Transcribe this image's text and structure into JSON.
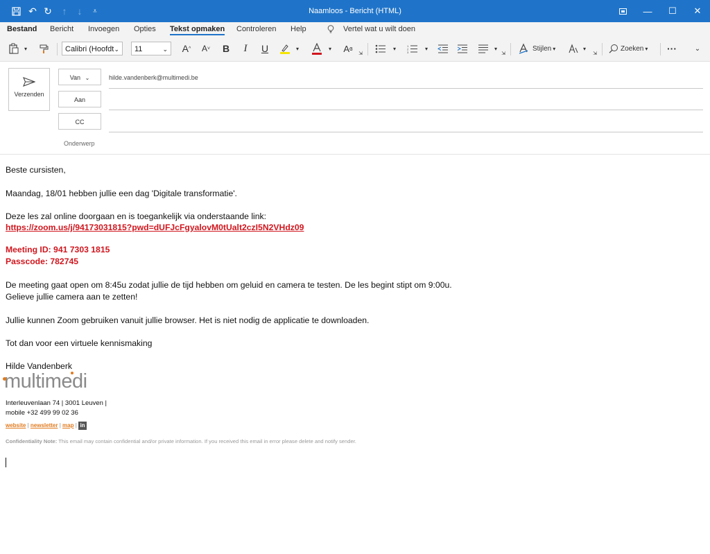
{
  "window": {
    "title": "Naamloos  -  Bericht (HTML)"
  },
  "tabs": [
    {
      "label": "Bestand"
    },
    {
      "label": "Bericht"
    },
    {
      "label": "Invoegen"
    },
    {
      "label": "Opties"
    },
    {
      "label": "Tekst opmaken"
    },
    {
      "label": "Controleren"
    },
    {
      "label": "Help"
    }
  ],
  "tellme": {
    "label": "Vertel wat u wilt doen"
  },
  "ribbon": {
    "font_name": "Calibri (Hoofdt",
    "font_size": "11",
    "styles_label": "Stijlen",
    "search_label": "Zoeken",
    "bold": "B",
    "italic": "I",
    "underline": "U",
    "grow": "A",
    "shrink": "A",
    "more": "···"
  },
  "compose": {
    "send_label": "Verzenden",
    "from_label": "Van",
    "from_value": "hilde.vandenberk@multimedi.be",
    "to_label": "Aan",
    "cc_label": "CC",
    "subject_label": "Onderwerp"
  },
  "body": {
    "greeting": "Beste cursisten,",
    "line1": "Maandag, 18/01 hebben jullie een dag 'Digitale transformatie'.",
    "line2": "Deze les zal online doorgaan en is toegankelijk via onderstaande link:",
    "link": "https://zoom.us/j/94173031815?pwd=dUFJcFgyalovM0tUalt2czI5N2VHdz09",
    "meeting_id": "Meeting ID: 941 7303 1815",
    "passcode": "Passcode: 782745",
    "line3": "De meeting gaat open om 8:45u zodat jullie de tijd hebben om geluid en camera te testen. De les begint stipt om 9:00u.",
    "line4": "Gelieve jullie camera aan te zetten!",
    "line5": "Jullie kunnen Zoom gebruiken vanuit jullie browser. Het is niet nodig de applicatie te downloaden.",
    "line6": "Tot dan voor een virtuele kennismaking",
    "signature_name": "Hilde Vandenberk",
    "logo_text": "multimedi",
    "address": "Interleuvenlaan 74 | 3001 Leuven |",
    "mobile": "mobile +32 499 99 02 36",
    "links": [
      "website",
      "newsletter",
      "map"
    ],
    "linkedin": "in",
    "conf_label": "Confidentiality Note:",
    "conf_text": " This email may contain confidential and/or private information. If you received this email in error please delete and notify sender."
  },
  "colors": {
    "titlebar": "#1f74c9",
    "accent_red": "#d0161e",
    "logo_gray": "#8a8a8a"
  }
}
